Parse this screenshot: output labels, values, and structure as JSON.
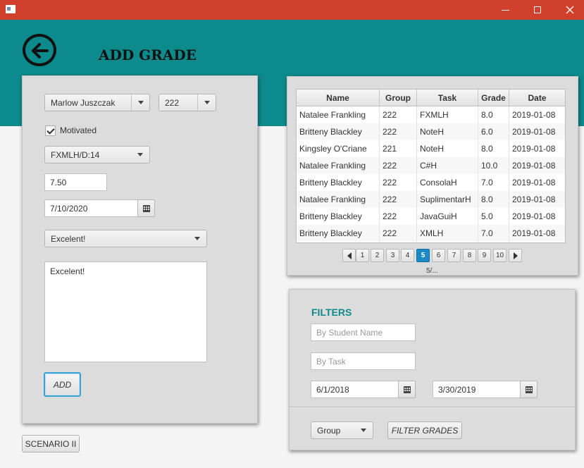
{
  "window": {
    "minimize": "—",
    "maximize": "☐",
    "close": "✕"
  },
  "header": {
    "title": "ADD GRADE"
  },
  "form": {
    "student": "Marlow Juszczak",
    "group": "222",
    "motivated_label": "Motivated",
    "motivated": true,
    "task": "FXMLH/D:14",
    "grade": "7.50",
    "date": "7/10/2020",
    "feedback_choice": "Excelent!",
    "feedback_text": "Excelent!",
    "add_label": "ADD"
  },
  "scenario_button": "SCENARIO II",
  "table": {
    "columns": [
      "Name",
      "Group",
      "Task",
      "Grade",
      "Date"
    ],
    "rows": [
      [
        "Natalee Frankling",
        "222",
        "FXMLH",
        "8.0",
        "2019-01-08"
      ],
      [
        "Britteny Blackley",
        "222",
        "NoteH",
        "6.0",
        "2019-01-08"
      ],
      [
        "Kingsley O'Criane",
        "221",
        "NoteH",
        "8.0",
        "2019-01-08"
      ],
      [
        "Natalee Frankling",
        "222",
        "C#H",
        "10.0",
        "2019-01-08"
      ],
      [
        "Britteny Blackley",
        "222",
        "ConsolaH",
        "7.0",
        "2019-01-08"
      ],
      [
        "Natalee Frankling",
        "222",
        "SuplimentarH",
        "8.0",
        "2019-01-08"
      ],
      [
        "Britteny Blackley",
        "222",
        "JavaGuiH",
        "5.0",
        "2019-01-08"
      ],
      [
        "Britteny Blackley",
        "222",
        "XMLH",
        "7.0",
        "2019-01-08"
      ]
    ]
  },
  "pagination": {
    "pages": [
      "1",
      "2",
      "3",
      "4",
      "5",
      "6",
      "7",
      "8",
      "9",
      "10"
    ],
    "current": "5",
    "label": "5/..."
  },
  "filters": {
    "title": "FILTERS",
    "student_placeholder": "By Student Name",
    "task_placeholder": "By Task",
    "date_from": "6/1/2018",
    "date_to": "3/30/2019",
    "group_select": "Group",
    "filter_button": "FILTER GRADES"
  },
  "colors": {
    "titlebar": "#d1402c",
    "header": "#0d8a8b",
    "accent": "#1a8ac6"
  }
}
